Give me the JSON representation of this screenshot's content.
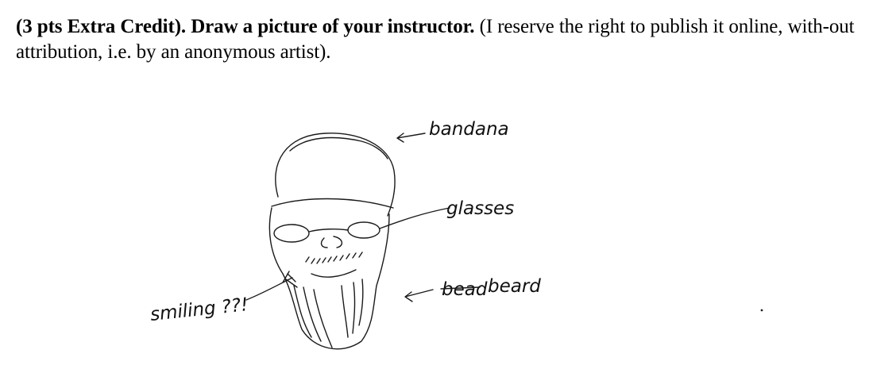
{
  "question": {
    "bold_part": "(3 pts Extra Credit). Draw a picture of your instructor.",
    "rest": " (I reserve the right to publish it online, with-out attribution, i.e. by an anonymous artist)."
  },
  "annotations": {
    "bandana": "bandana",
    "glasses": "glasses",
    "beard_struck": "bead",
    "beard": "beard",
    "smiling": "smiling ??!"
  }
}
